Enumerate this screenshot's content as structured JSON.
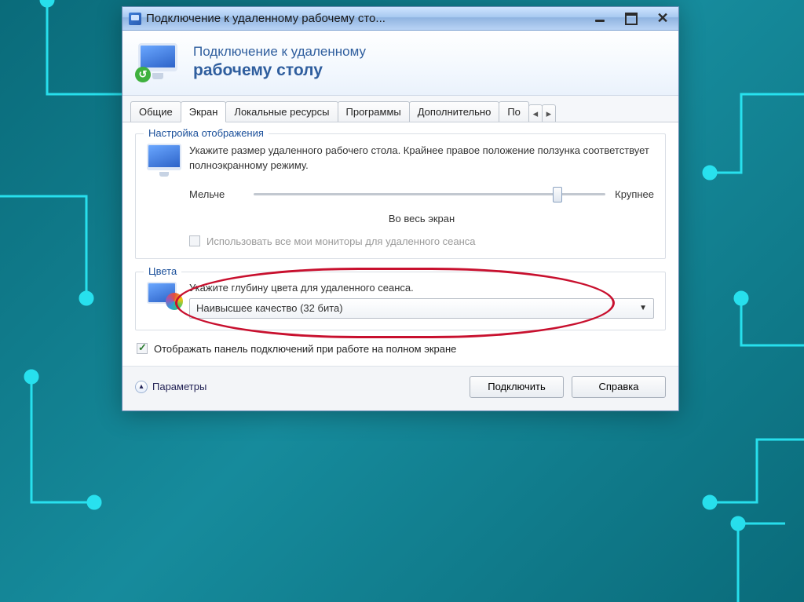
{
  "window": {
    "title": "Подключение к удаленному рабочему сто..."
  },
  "banner": {
    "line1": "Подключение к удаленному",
    "line2": "рабочему столу"
  },
  "tabs": {
    "items": [
      {
        "label": "Общие"
      },
      {
        "label": "Экран"
      },
      {
        "label": "Локальные ресурсы"
      },
      {
        "label": "Программы"
      },
      {
        "label": "Дополнительно"
      },
      {
        "label": "По"
      }
    ],
    "active_index": 1
  },
  "display_group": {
    "legend": "Настройка отображения",
    "hint": "Укажите размер удаленного рабочего стола. Крайнее правое положение ползунка соответствует полноэкранному режиму.",
    "slider": {
      "min_label": "Мельче",
      "max_label": "Крупнее",
      "value_percent": 85,
      "value_label": "Во весь экран"
    },
    "multi_monitor": {
      "label": "Использовать все мои мониторы для удаленного сеанса",
      "checked": false,
      "enabled": false
    }
  },
  "color_group": {
    "legend": "Цвета",
    "hint": "Укажите глубину цвета для удаленного сеанса.",
    "dropdown": {
      "selected": "Наивысшее качество (32 бита)"
    }
  },
  "show_bar": {
    "label": "Отображать панель подключений при работе на полном экране",
    "checked": true
  },
  "footer": {
    "options": "Параметры",
    "connect": "Подключить",
    "help": "Справка"
  }
}
